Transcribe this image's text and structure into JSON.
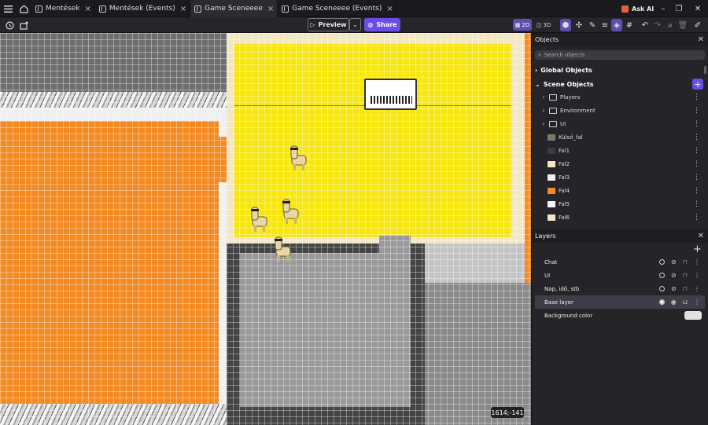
{
  "tabs": [
    {
      "label": "Mentések",
      "active": false
    },
    {
      "label": "Mentések (Events)",
      "active": false
    },
    {
      "label": "Game Sceneeee",
      "active": true
    },
    {
      "label": "Game Sceneeee (Events)",
      "active": false
    }
  ],
  "ask_ai": "Ask AI",
  "toolbar": {
    "preview_label": "Preview",
    "share_label": "Share",
    "mode_2d": "2D",
    "mode_3d": "3D"
  },
  "canvas": {
    "coordinates": "1614;-141"
  },
  "objects_panel": {
    "title": "Objects",
    "search_placeholder": "Search objects",
    "global_objects": "Global Objects",
    "scene_objects": "Scene Objects",
    "folders": [
      "Players",
      "Environment",
      "UI"
    ],
    "items": [
      {
        "label": "Külső_fal",
        "color": "#7a7a6a"
      },
      {
        "label": "Fal1",
        "color": "#3c3c3c"
      },
      {
        "label": "Fal2",
        "color": "#f3e6c4"
      },
      {
        "label": "Fal3",
        "color": "#eeeeee"
      },
      {
        "label": "Fal4",
        "color": "#f48a22"
      },
      {
        "label": "Fal5",
        "color": "#f5f5f5"
      },
      {
        "label": "Fal6",
        "color": "#f3e6c4"
      }
    ]
  },
  "layers_panel": {
    "title": "Layers",
    "layers": [
      {
        "label": "Chat",
        "selected": false
      },
      {
        "label": "UI",
        "selected": false
      },
      {
        "label": "Nap, idő, stb",
        "selected": false
      },
      {
        "label": "Base layer",
        "selected": true
      }
    ],
    "background_label": "Background color",
    "background_color": "#e0e0e0"
  }
}
